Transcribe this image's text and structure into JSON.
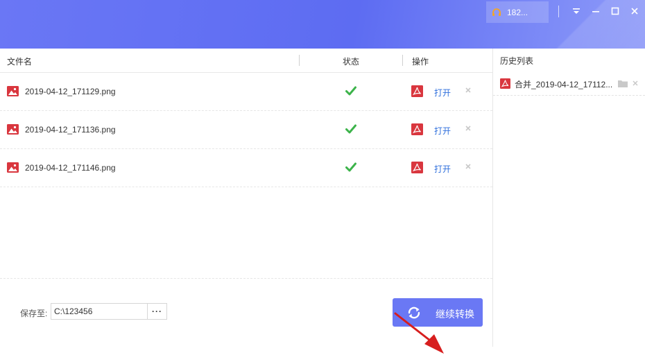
{
  "titlebar": {
    "user_label": "182...",
    "icons": [
      "headset-icon",
      "dropdown-menu-icon",
      "minimize-icon",
      "maximize-icon",
      "close-icon"
    ],
    "accent": "#5d6cf2"
  },
  "table": {
    "headers": {
      "filename": "文件名",
      "status": "状态",
      "action": "操作"
    },
    "rows": [
      {
        "filename": "2019-04-12_171129.png",
        "status": "success",
        "open_label": "打开"
      },
      {
        "filename": "2019-04-12_171136.png",
        "status": "success",
        "open_label": "打开"
      },
      {
        "filename": "2019-04-12_171146.png",
        "status": "success",
        "open_label": "打开"
      }
    ]
  },
  "footer": {
    "save_label": "保存至:",
    "save_path": "C:\\123456",
    "browse_label": "···",
    "convert_label": "继续转换"
  },
  "history": {
    "title": "历史列表",
    "items": [
      {
        "name": "合并_2019-04-12_17112..."
      }
    ]
  },
  "colors": {
    "link": "#2f6fdc",
    "success": "#3cb34a",
    "pdf_red": "#d9363e",
    "button": "#6a78f4"
  }
}
